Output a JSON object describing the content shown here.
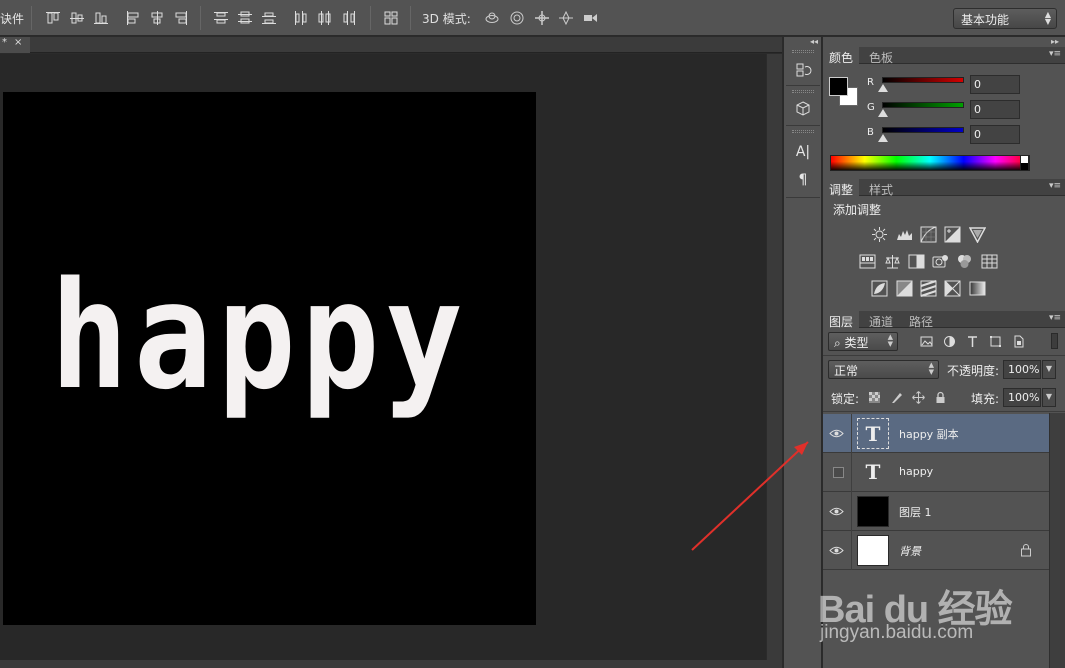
{
  "optionsbar": {
    "cut_label": "诀件",
    "mode3d_label": "3D 模式:",
    "workspace": "基本功能",
    "align_icons": [
      "align-top-icon",
      "align-vcenter-icon",
      "align-bottom-icon",
      "align-left-icon",
      "align-hcenter-icon",
      "align-right-icon"
    ],
    "distribute_icons": [
      "dist-top-icon",
      "dist-vcenter-icon",
      "dist-bottom-icon",
      "dist-left-icon",
      "dist-hcenter-icon",
      "dist-right-icon"
    ],
    "mode3d_icons": [
      "orbit-3d-icon",
      "roll-3d-icon",
      "drag-3d-icon",
      "slide-3d-icon",
      "scale-3d-icon"
    ]
  },
  "document": {
    "tab_mark": "*",
    "tab_close": "×",
    "canvas_text": "happy"
  },
  "sidedock": {
    "buttons": [
      "history-icon",
      "3d-icon",
      "character-icon",
      "paragraph-icon"
    ],
    "character_glyph": "A|",
    "paragraph_glyph": "¶"
  },
  "color_panel": {
    "tabs": [
      "颜色",
      "色板"
    ],
    "channels": [
      {
        "label": "R",
        "value": "0"
      },
      {
        "label": "G",
        "value": "0"
      },
      {
        "label": "B",
        "value": "0"
      }
    ],
    "channel_colors": [
      "#d40000",
      "#00a000",
      "#0000c8"
    ]
  },
  "adjust_panel": {
    "tabs": [
      "调整",
      "样式"
    ],
    "title": "添加调整",
    "icons": [
      [
        "brightness-icon",
        "levels-icon",
        "curves-icon",
        "exposure-icon",
        "vibrance-icon"
      ],
      [
        "hue-saturation-icon",
        "color-balance-icon",
        "black-white-icon",
        "photo-filter-icon",
        "channel-mixer-icon",
        "color-lookup-icon"
      ],
      [
        "invert-icon",
        "posterize-icon",
        "threshold-icon",
        "selective-color-icon",
        "gradient-map-icon"
      ]
    ]
  },
  "layers_panel": {
    "tabs": [
      "图层",
      "通道",
      "路径"
    ],
    "filter_kind": "类型",
    "blend_mode": "正常",
    "opacity_label": "不透明度:",
    "opacity": "100%",
    "lock_label": "锁定:",
    "fill_label": "填充:",
    "fill": "100%",
    "layers": [
      {
        "name": "happy 副本",
        "kind": "text",
        "visible": true,
        "selected": true
      },
      {
        "name": "happy",
        "kind": "text",
        "visible": false,
        "selected": false
      },
      {
        "name": "图层 1",
        "kind": "pixel",
        "thumb_color": "#000000",
        "visible": true,
        "selected": false
      },
      {
        "name": "背景",
        "kind": "background",
        "thumb_color": "#ffffff",
        "visible": true,
        "selected": false,
        "locked": true
      }
    ],
    "text_glyph": "T"
  },
  "annotation": {
    "color": "#e0302a"
  },
  "watermark": {
    "brand": "Bai du 经验",
    "url": "jingyan.baidu.com"
  }
}
